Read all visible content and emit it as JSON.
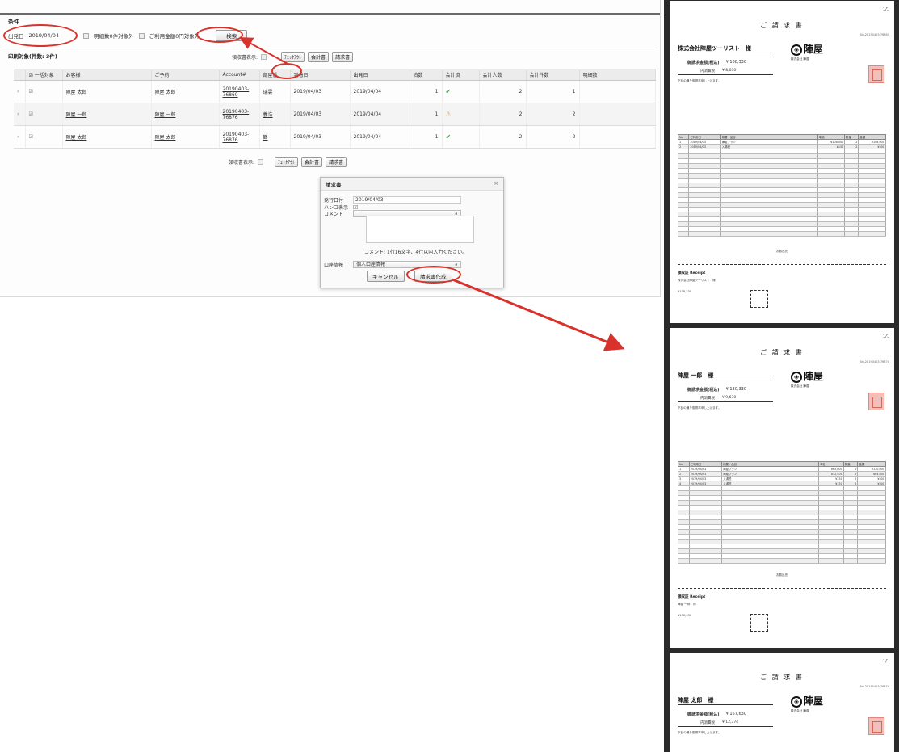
{
  "app": {
    "panel_title": "条件",
    "conditions": {
      "date_label": "出発日",
      "date_value": "2019/04/04",
      "option1_label": "明細数0件対象外",
      "option2_label": "ご利用金額0円対象外",
      "search_button": "検索"
    },
    "list_title": "印刷対象(件数: 3件)",
    "toolbar": {
      "receipt_display_label": "領収書表示:",
      "checkout_button": "ﾁｪｯｸｱｳﾄ",
      "settle_button": "会計書",
      "invoice_button": "請求書"
    },
    "table": {
      "headers": [
        "",
        "一括対象",
        "お客様",
        "ご予約",
        "Account#",
        "部屋番",
        "到着日",
        "出発日",
        "泊数",
        "会計済",
        "会計人数",
        "会計件数",
        "明細数"
      ],
      "rows": [
        {
          "target": "☑",
          "customer": "陣屋 太郎",
          "booking": "陣屋 太郎",
          "account": "20190403-76860",
          "room": "瑞雲",
          "arrival": "2019/04/03",
          "departure": "2019/04/04",
          "nights": "1",
          "paid": "✔",
          "people": "2",
          "count": "1"
        },
        {
          "target": "☑",
          "customer": "陣屋 一郎",
          "booking": "陣屋 一郎",
          "account": "20190403-76876",
          "room": "養浩",
          "arrival": "2019/04/03",
          "departure": "2019/04/04",
          "nights": "1",
          "paid": "⚠",
          "people": "2",
          "count": "2"
        },
        {
          "target": "☑",
          "customer": "陣屋 太郎",
          "booking": "陣屋 太郎",
          "account": "20190403-76876",
          "room": "鶴",
          "arrival": "2019/04/03",
          "departure": "2019/04/04",
          "nights": "1",
          "paid": "✔",
          "people": "2",
          "count": "2"
        }
      ]
    },
    "dialog": {
      "title": "請求書",
      "close": "×",
      "issue_date_label": "発行日付",
      "issue_date_value": "2019/04/03",
      "seal_label": "ハンコ表示",
      "seal_value": "☑",
      "comment_label": "コメント",
      "comment_hint": "コメント: 1行16文字、4行以内入力ください。",
      "account_label": "口座情報",
      "account_value": "個人口座情報",
      "cancel_button": "キャンセル",
      "create_button": "請求書作成"
    }
  },
  "invoices": [
    {
      "page_num": "1/1",
      "title": "ご 請 求 書",
      "doc_no": "No.20190403-76860",
      "addressee": "株式会社陣屋ツーリスト　様",
      "amount_label": "御請求金額(税込)",
      "amount_value": "¥ 108,330",
      "tax_label": "内消費税",
      "tax_value": "¥ 8,030",
      "message": "下記の通り御請求申し上げます。",
      "logo": "陣屋",
      "company": "株式会社 陣屋",
      "table_headers": [
        "No",
        "ご利用日",
        "摘要・品目",
        "単価",
        "数量",
        "金額"
      ],
      "items": [
        [
          "1",
          "2019/04/03",
          "陣屋プラン",
          "¥108,000",
          "2",
          "¥108,000"
        ],
        [
          "2",
          "2019/04/03",
          "入湯税",
          "¥150",
          "2",
          "¥300"
        ]
      ],
      "bank": "お振込先",
      "receipt_title": "領収証 Receipt",
      "receipt_to": "株式会社陣屋ツーリスト　様",
      "receipt_amount": "¥108,330"
    },
    {
      "page_num": "1/1",
      "title": "ご 請 求 書",
      "doc_no": "No.20190403-76876",
      "addressee": "陣屋 一郎　様",
      "amount_label": "御請求金額(税込)",
      "amount_value": "¥ 130,330",
      "tax_label": "内消費税",
      "tax_value": "¥ 9,630",
      "message": "下記の通り御請求申し上げます。",
      "logo": "陣屋",
      "company": "株式会社 陣屋",
      "table_headers": [
        "No",
        "ご利用日",
        "摘要・品目",
        "単価",
        "数量",
        "金額"
      ],
      "items": [
        [
          "1",
          "2019/04/03",
          "陣屋プラン",
          "¥65,000",
          "2",
          "¥130,000"
        ],
        [
          "2",
          "2019/04/03",
          "陣屋プラン",
          "¥32,400",
          "2",
          "¥64,800"
        ],
        [
          "3",
          "2019/04/03",
          "入湯税",
          "¥150",
          "2",
          "¥300"
        ],
        [
          "4",
          "2019/04/03",
          "入湯税",
          "¥150",
          "2",
          "¥300"
        ]
      ],
      "bank": "お振込先",
      "receipt_title": "領収証 Receipt",
      "receipt_to": "陣屋 一郎　様",
      "receipt_amount": "¥130,330"
    },
    {
      "page_num": "1/1",
      "title": "ご 請 求 書",
      "doc_no": "No.20190403-76876",
      "addressee": "陣屋 太郎　様",
      "amount_label": "御請求金額(税込)",
      "amount_value": "¥ 167,630",
      "tax_label": "内消費税",
      "tax_value": "¥ 12,374",
      "message": "下記の通り御請求申し上げます。",
      "logo": "陣屋",
      "company": "株式会社 陣屋",
      "table_headers": [
        "No",
        "ご利用日",
        "摘要・品目",
        "単価",
        "数量",
        "金額"
      ],
      "items": [],
      "bank": "",
      "receipt_title": "",
      "receipt_to": "",
      "receipt_amount": ""
    }
  ],
  "colors": {
    "annotation_red": "#d9312b",
    "paid_check": "#41a84a",
    "paid_warning": "#e79a3b"
  }
}
